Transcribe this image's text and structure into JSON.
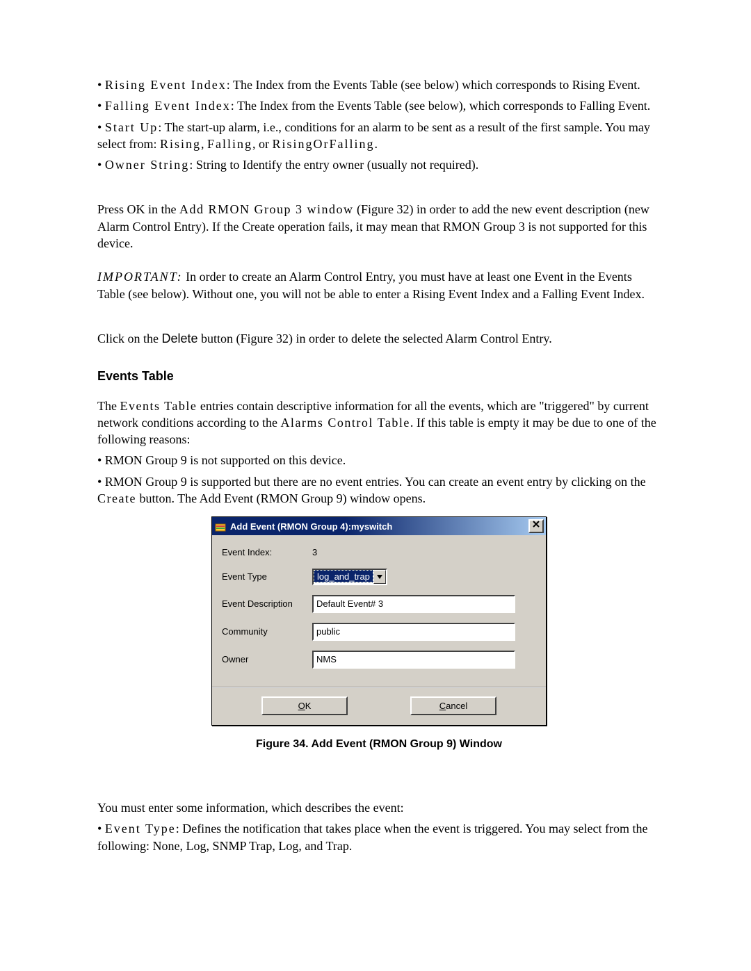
{
  "doc": {
    "bullets_top": [
      {
        "term": "Rising Event Index",
        "rest": ":  The Index from the Events Table (see below) which corresponds to Rising Event."
      },
      {
        "term": "Falling Event Index",
        "rest": ": The Index from the Events Table (see below), which corresponds to Falling Event."
      },
      {
        "term": "Start Up",
        "rest": ": The start-up alarm, i.e., conditions for an alarm to be sent as a result of the first sample.  You may select from: ",
        "tail_terms": [
          "Rising",
          ", ",
          "Falling",
          ", or ",
          "RisingOrFalling",
          "."
        ]
      },
      {
        "term": "Owner String",
        "rest": ": String to Identify the entry owner (usually not required)."
      }
    ],
    "p_pressok_1": "Press OK in the ",
    "p_pressok_term": "Add RMON Group 3 window",
    "p_pressok_2": "  (Figure 32) in order to add the new event description (new Alarm Control Entry). If the Create operation fails, it may mean that RMON Group 3 is not supported for this device.",
    "important_label": "IMPORTANT:",
    "important_text": " In order to create an Alarm Control Entry, you must have at least one Event in the Events Table (see below). Without one, you will not be able to enter a Rising Event Index and a Falling Event Index.",
    "delete_1": "Click on the ",
    "delete_btn": "Delete",
    "delete_2": " button (Figure 32) in order to delete the selected Alarm Control Entry.",
    "section_head": "Events Table",
    "events_para_1a": "The ",
    "events_para_1_term1": "Events Table",
    "events_para_1b": " entries contain descriptive information for all the events, which are \"triggered\" by current network conditions according to the ",
    "events_para_1_term2": "Alarms Control Table",
    "events_para_1c": ". If this table is empty it may be due to one of the following reasons:",
    "events_b1": "• RMON Group 9 is not supported on this device.",
    "events_b2a": "• RMON Group 9 is supported but there are no event entries.  You can create an event entry by clicking on the ",
    "events_b2_term": "Create",
    "events_b2b": " button. The Add Event (RMON Group 9) window opens.",
    "caption": "Figure 34. Add Event (RMON Group 9) Window",
    "tail_p": "You must enter some information, which describes the event:",
    "tail_b_term": "Event Type",
    "tail_b_rest": ": Defines the notification that takes place when the event is triggered. You may select from the following: None, Log, SNMP Trap, Log, and Trap."
  },
  "dialog": {
    "title": "Add Event (RMON Group 4):myswitch",
    "close": "×",
    "labels": {
      "event_index": "Event Index:",
      "event_type": "Event Type",
      "event_desc": "Event Description",
      "community": "Community",
      "owner": "Owner"
    },
    "values": {
      "event_index": "3",
      "event_type": "log_and_trap",
      "event_desc": "Default Event# 3",
      "community": "public",
      "owner": "NMS"
    },
    "buttons": {
      "ok_u": "O",
      "ok_r": "K",
      "cancel_u": "C",
      "cancel_r": "ancel"
    }
  }
}
